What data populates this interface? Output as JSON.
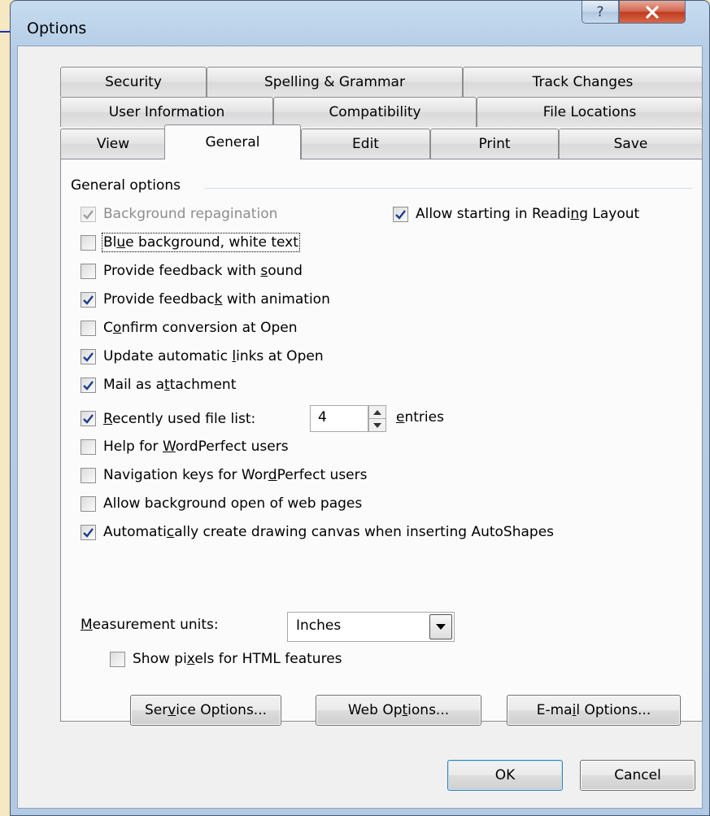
{
  "window": {
    "title": "Options",
    "help_icon": "question-mark-icon",
    "close_icon": "close-x-icon",
    "close_color": "#c0391d"
  },
  "tabs": {
    "row1": [
      "Security",
      "Spelling & Grammar",
      "Track Changes"
    ],
    "row2": [
      "User Information",
      "Compatibility",
      "File Locations"
    ],
    "row3": [
      "View",
      "General",
      "Edit",
      "Print",
      "Save"
    ],
    "active": "General"
  },
  "general": {
    "group_title": "General options",
    "options": {
      "background_repagination": {
        "label": "Background repagination",
        "checked": true,
        "disabled": true
      },
      "allow_reading_layout": {
        "pre": "Allow starting in Readi",
        "key": "n",
        "post": "g Layout",
        "checked": true
      },
      "blue_background": {
        "pre": "Bl",
        "key": "u",
        "post": "e background, white text",
        "checked": false
      },
      "feedback_sound": {
        "pre": "Provide feedback with ",
        "key": "s",
        "post": "ound",
        "checked": false
      },
      "feedback_animation": {
        "pre": "Provide feedbac",
        "key": "k",
        "post": " with animation",
        "checked": true
      },
      "confirm_conversion": {
        "pre": "C",
        "key": "o",
        "post": "nfirm conversion at Open",
        "checked": false
      },
      "update_links": {
        "pre": "Update automatic ",
        "key": "l",
        "post": "inks at Open",
        "checked": true
      },
      "mail_attachment": {
        "pre": "Mail as a",
        "key": "t",
        "post": "tachment",
        "checked": true
      },
      "recent_files": {
        "pre": "",
        "key": "R",
        "post": "ecently used file list:",
        "checked": true
      },
      "help_wordperfect": {
        "pre": "Help for ",
        "key": "W",
        "post": "ordPerfect users",
        "checked": false
      },
      "nav_keys_wordperfect": {
        "pre": "Navigation keys for Wor",
        "key": "d",
        "post": "Perfect users",
        "checked": false
      },
      "background_open_web": {
        "pre": "Allow back",
        "key": "g",
        "post": "round open of web pages",
        "checked": false
      },
      "drawing_canvas": {
        "pre": "Automati",
        "key": "c",
        "post": "ally create drawing canvas when inserting AutoShapes",
        "checked": true
      },
      "show_pixels": {
        "pre": "Show pi",
        "key": "x",
        "post": "els for HTML features",
        "checked": false
      }
    },
    "recent_files_count": "4",
    "entries_label": {
      "pre": "",
      "key": "e",
      "post": "ntries"
    },
    "measurement_label": {
      "pre": "",
      "key": "M",
      "post": "easurement units:"
    },
    "measurement_value": "Inches"
  },
  "buttons": {
    "service": {
      "pre": "Ser",
      "key": "v",
      "post": "ice Options..."
    },
    "web": {
      "pre": "Web Op",
      "key": "t",
      "post": "ions..."
    },
    "email": {
      "pre": "E-ma",
      "key": "i",
      "post": "l Options..."
    },
    "ok": "OK",
    "cancel": "Cancel"
  }
}
